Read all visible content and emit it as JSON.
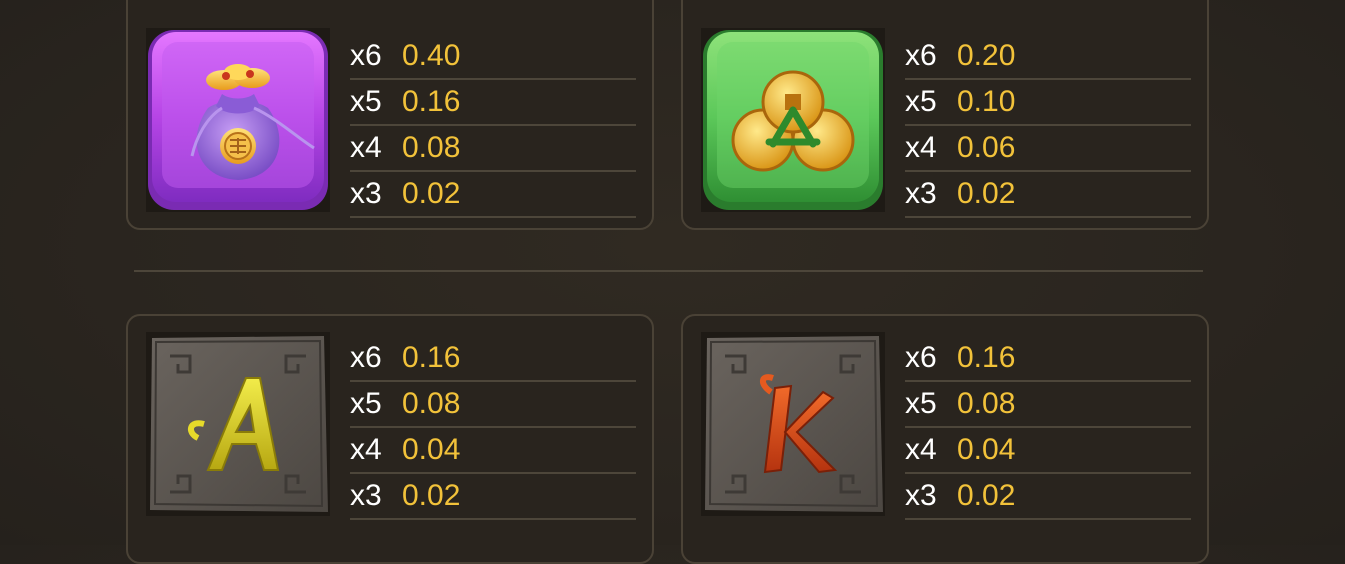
{
  "symbols": [
    {
      "id": "bag",
      "icon": "lucky-bag-icon",
      "tile_color": "#b347e8",
      "payouts": [
        {
          "mult": "x6",
          "value": "0.40"
        },
        {
          "mult": "x5",
          "value": "0.16"
        },
        {
          "mult": "x4",
          "value": "0.08"
        },
        {
          "mult": "x3",
          "value": "0.02"
        }
      ]
    },
    {
      "id": "coins",
      "icon": "gold-coins-icon",
      "tile_color": "#5cc85a",
      "payouts": [
        {
          "mult": "x6",
          "value": "0.20"
        },
        {
          "mult": "x5",
          "value": "0.10"
        },
        {
          "mult": "x4",
          "value": "0.06"
        },
        {
          "mult": "x3",
          "value": "0.02"
        }
      ]
    },
    {
      "id": "letter-a",
      "icon": "stone-letter-a-icon",
      "tile_color": "#5a5550",
      "payouts": [
        {
          "mult": "x6",
          "value": "0.16"
        },
        {
          "mult": "x5",
          "value": "0.08"
        },
        {
          "mult": "x4",
          "value": "0.04"
        },
        {
          "mult": "x3",
          "value": "0.02"
        }
      ]
    },
    {
      "id": "letter-k",
      "icon": "stone-letter-k-icon",
      "tile_color": "#5a5550",
      "payouts": [
        {
          "mult": "x6",
          "value": "0.16"
        },
        {
          "mult": "x5",
          "value": "0.08"
        },
        {
          "mult": "x4",
          "value": "0.04"
        },
        {
          "mult": "x3",
          "value": "0.02"
        }
      ]
    }
  ],
  "colors": {
    "background": "#2a251f",
    "panel_border": "#4a4236",
    "multiplier_text": "#ffffff",
    "payout_text": "#f2c23a"
  }
}
